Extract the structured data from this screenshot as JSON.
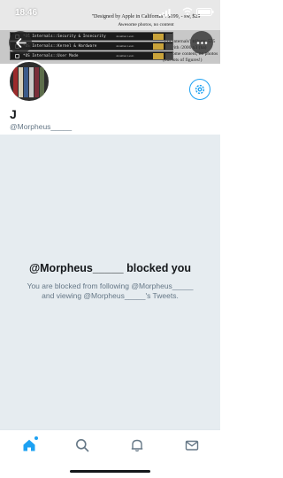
{
  "status_bar": {
    "time": "18.46"
  },
  "banner": {
    "caption_line1": "\"Designed by Apple in California\": $199, - sw, $29",
    "caption_line2": "Awesome photos, no content",
    "caption_right": "\"OS Internals\" trilogy: 575 x3 (with /2000 x3 (ha) awesome content, no photos (but lots of figures!)",
    "books": [
      {
        "title": "*OS Internals::Security & Insecurity",
        "author": "Jonathan Levin"
      },
      {
        "title": "*OS Internals::Kernel & Hardware",
        "author": "Jonathan Levin"
      },
      {
        "title": "*OS Internals::User Mode",
        "author": "Jonathan Levin"
      }
    ]
  },
  "profile": {
    "name": "J",
    "handle": "@Morpheus_____"
  },
  "blocked": {
    "title": "@Morpheus_____ blocked you",
    "message": "You are blocked from following @Morpheus_____ and viewing @Morpheus_____'s Tweets."
  },
  "tab_bar": {
    "tabs": [
      "home",
      "search",
      "notifications",
      "messages"
    ],
    "active": "home"
  },
  "colors": {
    "accent": "#1da1f2",
    "background_gray": "#e6ecf0",
    "text_primary": "#14171a",
    "text_secondary": "#657786"
  },
  "icons": [
    "signal-icon",
    "wifi-icon",
    "battery-icon",
    "back-arrow-icon",
    "more-icon",
    "gear-icon",
    "home-icon",
    "search-icon",
    "bell-icon",
    "mail-icon"
  ]
}
